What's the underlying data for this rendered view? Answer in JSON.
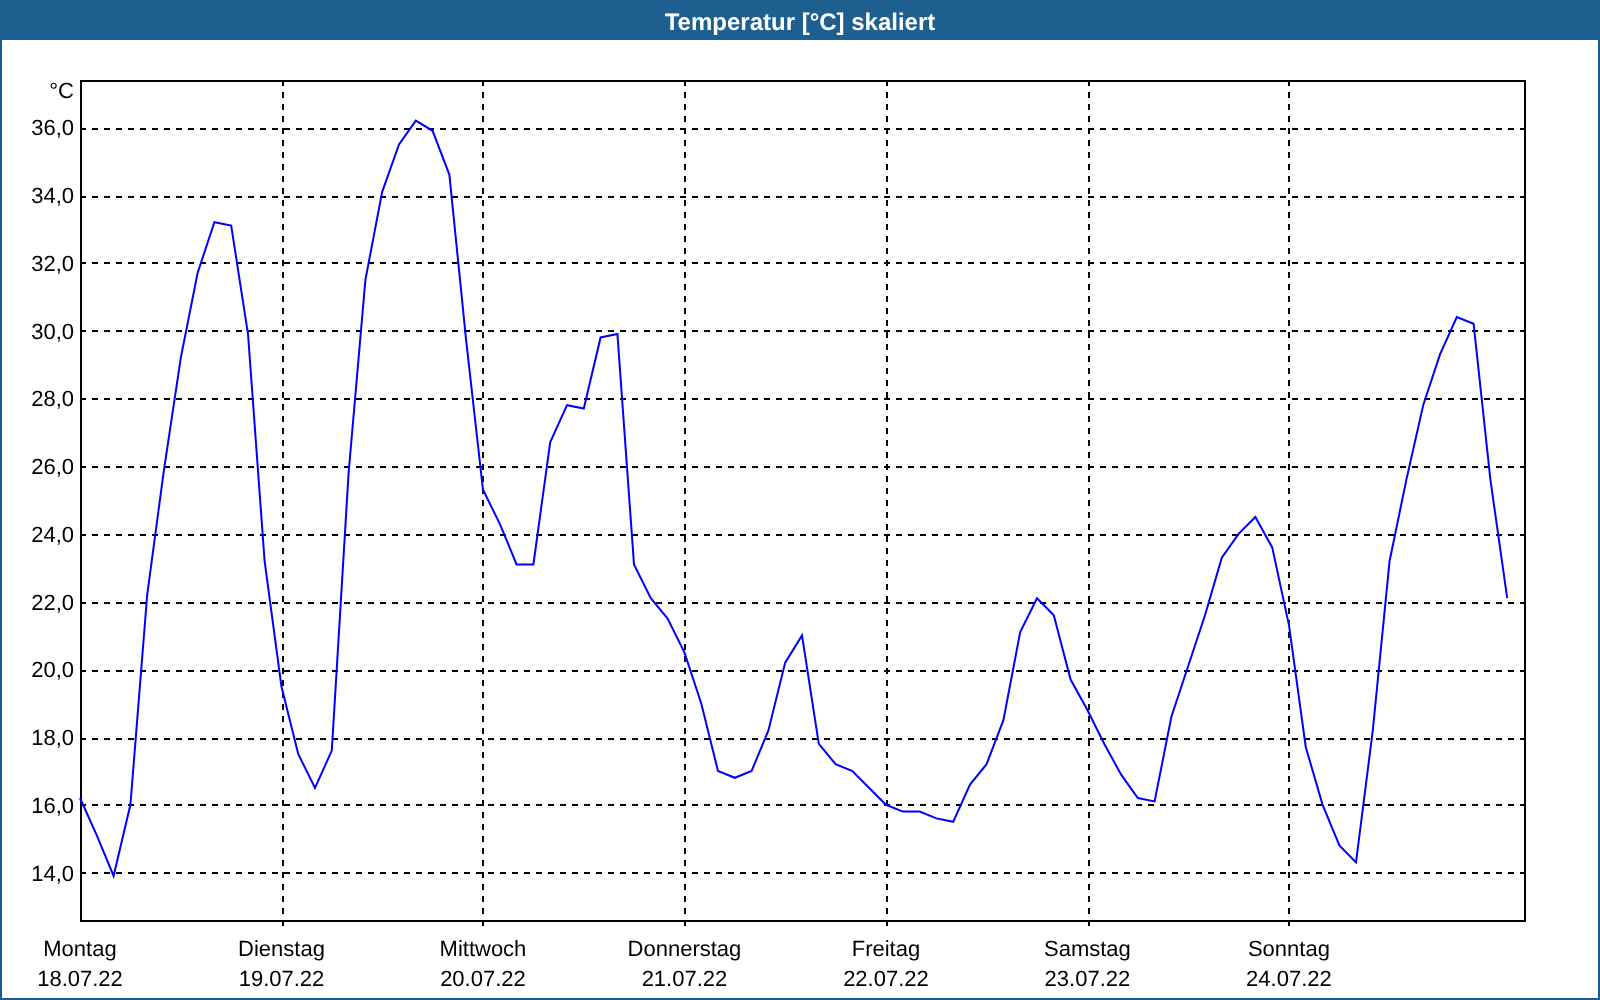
{
  "window": {
    "title": "Temperatur [°C] skaliert"
  },
  "chart": {
    "chart_data": {
      "type": "line",
      "ylabel": "°C",
      "grid": true,
      "ylim": [
        12.6,
        37.4
      ],
      "categories": [
        "Montag\n18.07.22",
        null,
        null,
        null,
        null,
        null,
        null,
        null,
        null,
        null,
        null,
        null,
        "Dienstag\n19.07.22",
        null,
        null,
        null,
        null,
        null,
        null,
        null,
        null,
        null,
        null,
        null,
        "Mittwoch\n20.07.22",
        null,
        null,
        null,
        null,
        null,
        null,
        null,
        null,
        null,
        null,
        null,
        "Donnerstag\n21.07.22",
        null,
        null,
        null,
        null,
        null,
        null,
        null,
        null,
        null,
        null,
        null,
        "Freitag\n22.07.22",
        null,
        null,
        null,
        null,
        null,
        null,
        null,
        null,
        null,
        null,
        null,
        "Samstag\n23.07.22",
        null,
        null,
        null,
        null,
        null,
        null,
        null,
        null,
        null,
        null,
        null,
        "Sonntag\n24.07.22",
        null,
        null,
        null,
        null,
        null,
        null,
        null,
        null,
        null,
        null,
        null,
        null,
        null
      ],
      "yticks": [
        {
          "value": 14,
          "label": "14,0"
        },
        {
          "value": 16,
          "label": "16,0"
        },
        {
          "value": 18,
          "label": "18,0"
        },
        {
          "value": 20,
          "label": "20,0"
        },
        {
          "value": 22,
          "label": "22,0"
        },
        {
          "value": 24,
          "label": "24,0"
        },
        {
          "value": 26,
          "label": "26,0"
        },
        {
          "value": 28,
          "label": "28,0"
        },
        {
          "value": 30,
          "label": "30,0"
        },
        {
          "value": 32,
          "label": "32,0"
        },
        {
          "value": 34,
          "label": "34,0"
        },
        {
          "value": 36,
          "label": "36,0"
        }
      ],
      "series": [
        {
          "color": "#0000ff",
          "values": [
            16.2,
            15.1,
            13.9,
            16.0,
            22.2,
            25.9,
            29.2,
            31.7,
            33.2,
            33.1,
            29.9,
            23.2,
            19.5,
            17.5,
            16.5,
            17.6,
            25.8,
            31.5,
            34.1,
            35.5,
            36.2,
            35.9,
            34.6,
            29.7,
            25.3,
            24.3,
            23.1,
            23.1,
            26.7,
            27.8,
            27.7,
            29.8,
            29.9,
            23.1,
            22.1,
            21.5,
            20.5,
            19.0,
            17.0,
            16.8,
            17.0,
            18.2,
            20.2,
            21.0,
            17.8,
            17.2,
            17.0,
            16.5,
            16.0,
            15.8,
            15.8,
            15.6,
            15.5,
            16.6,
            17.2,
            18.5,
            21.1,
            22.1,
            21.6,
            19.7,
            18.8,
            17.8,
            16.9,
            16.2,
            16.1,
            18.6,
            20.1,
            21.6,
            23.3,
            24.0,
            24.5,
            23.6,
            21.3,
            17.7,
            16.0,
            14.8,
            14.3,
            18.2,
            23.2,
            25.6,
            27.8,
            29.3,
            30.4,
            30.2,
            25.6,
            22.1
          ]
        }
      ]
    }
  }
}
